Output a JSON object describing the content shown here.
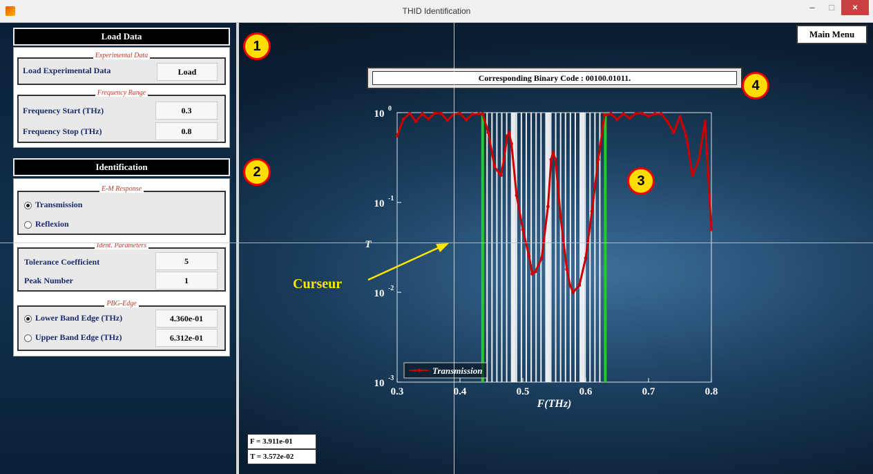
{
  "window": {
    "title": "THID Identification",
    "controls": {
      "minimize": "–",
      "maximize": "□",
      "close": "×"
    }
  },
  "load_data": {
    "header": "Load Data",
    "experimental": {
      "legend": "Experimental Data",
      "label": "Load Experimental Data",
      "button": "Load"
    },
    "frequency_range": {
      "legend": "Frequency Range",
      "start_label": "Frequency Start  (THz)",
      "start_value": "0.3",
      "stop_label": "Frequency Stop (THz)",
      "stop_value": "0.8"
    }
  },
  "identification": {
    "header": "Identification",
    "em_response": {
      "legend": "E-M Response",
      "options": [
        "Transmission",
        "Reflexion"
      ],
      "selected": "Transmission"
    },
    "ident_params": {
      "legend": "Ident. Parameters",
      "tolerance_label": "Tolerance Coefficient",
      "tolerance_value": "5",
      "peak_label": "Peak Number",
      "peak_value": "1"
    },
    "pbg_edge": {
      "legend": "PBG-Edge",
      "lower_label": "Lower Band Edge (THz)",
      "lower_value": "4.360e-01",
      "upper_label": "Upper Band Edge (THz)",
      "upper_value": "6.312e-01",
      "selected": "lower"
    }
  },
  "main_menu": "Main Menu",
  "binary_code": "Corresponding Binary Code : 00100.01011.",
  "annotations": {
    "n1": "1",
    "n2": "2",
    "n3": "3",
    "n4": "4",
    "curseur": "Curseur",
    "annotation_color": "#ffe600",
    "marker_fill": "#ffdd00",
    "marker_border": "#ee0000"
  },
  "readout": {
    "f": "F = 3.911e-01",
    "t": "T = 3.572e-02"
  },
  "cursor": {
    "f": 0.3911,
    "t": 0.03572
  },
  "chart_data": {
    "type": "line",
    "xlabel": "F(THz)",
    "ylabel": "T",
    "xlim": [
      0.3,
      0.8
    ],
    "ylim": [
      0.001,
      1
    ],
    "yscale": "log",
    "x_ticks": [
      "0.3",
      "0.4",
      "0.5",
      "0.6",
      "0.7",
      "0.8"
    ],
    "y_ticks": [
      {
        "base": "10",
        "exp": "0",
        "v": 1
      },
      {
        "base": "10",
        "exp": "-1",
        "v": 0.1
      },
      {
        "base": "10",
        "exp": "-2",
        "v": 0.01
      },
      {
        "base": "10",
        "exp": "-3",
        "v": 0.001
      }
    ],
    "legend": "Transmission",
    "legend_position": "bottom-left",
    "series_color": "#cc0000",
    "band_edges": [
      0.436,
      0.6312
    ],
    "band_edge_color": "#22cc22",
    "series": [
      {
        "name": "Transmission",
        "x": [
          0.3,
          0.31,
          0.32,
          0.33,
          0.34,
          0.35,
          0.36,
          0.37,
          0.38,
          0.39,
          0.4,
          0.41,
          0.42,
          0.43,
          0.436,
          0.445,
          0.455,
          0.465,
          0.47,
          0.475,
          0.478,
          0.482,
          0.49,
          0.5,
          0.51,
          0.515,
          0.52,
          0.53,
          0.54,
          0.545,
          0.548,
          0.552,
          0.56,
          0.57,
          0.575,
          0.58,
          0.59,
          0.6,
          0.61,
          0.62,
          0.63,
          0.64,
          0.65,
          0.66,
          0.67,
          0.68,
          0.69,
          0.7,
          0.71,
          0.72,
          0.73,
          0.74,
          0.75,
          0.755,
          0.76,
          0.77,
          0.78,
          0.79,
          0.795,
          0.8
        ],
        "y": [
          0.55,
          0.85,
          0.98,
          0.8,
          0.97,
          0.85,
          0.99,
          0.98,
          0.82,
          0.96,
          0.98,
          0.83,
          0.96,
          0.97,
          0.97,
          0.6,
          0.25,
          0.2,
          0.3,
          0.55,
          0.6,
          0.45,
          0.12,
          0.05,
          0.025,
          0.016,
          0.017,
          0.024,
          0.09,
          0.3,
          0.36,
          0.3,
          0.07,
          0.018,
          0.012,
          0.01,
          0.012,
          0.024,
          0.08,
          0.3,
          0.94,
          0.97,
          0.84,
          0.97,
          0.87,
          0.98,
          0.98,
          0.91,
          0.97,
          0.97,
          0.8,
          0.6,
          0.9,
          0.7,
          0.55,
          0.2,
          0.3,
          0.8,
          0.2,
          0.05
        ]
      }
    ]
  }
}
